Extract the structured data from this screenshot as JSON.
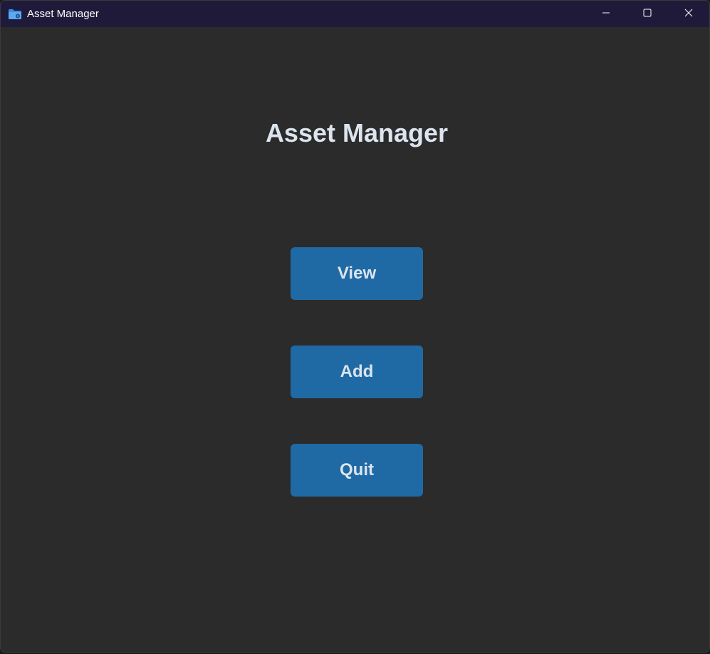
{
  "window": {
    "title": "Asset Manager",
    "controls": {
      "minimize": "minimize-icon",
      "maximize": "maximize-icon",
      "close": "close-icon"
    }
  },
  "main": {
    "heading": "Asset Manager",
    "buttons": [
      {
        "label": "View"
      },
      {
        "label": "Add"
      },
      {
        "label": "Quit"
      }
    ]
  },
  "colors": {
    "titlebar": "#201a3a",
    "background": "#2b2b2b",
    "button": "#1f6aa5",
    "text": "#dce4ee"
  }
}
